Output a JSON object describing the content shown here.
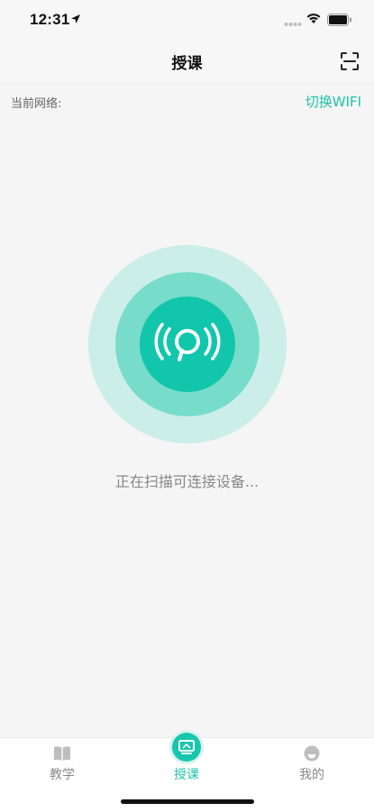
{
  "status_bar": {
    "time": "12:31"
  },
  "nav": {
    "title": "授课"
  },
  "network": {
    "label": "当前网络:",
    "switch_label": "切换WIFI"
  },
  "scanner": {
    "status_text": "正在扫描可连接设备..."
  },
  "tabs": [
    {
      "label": "教学",
      "icon": "book-icon",
      "active": false
    },
    {
      "label": "授课",
      "icon": "monitor-icon",
      "active": true
    },
    {
      "label": "我的",
      "icon": "profile-icon",
      "active": false
    }
  ],
  "colors": {
    "accent": "#20c2ab",
    "ring_outer": "#cbeee8",
    "ring_middle": "#78dcca",
    "ring_inner": "#12c6ac",
    "background": "#f5f5f5"
  }
}
